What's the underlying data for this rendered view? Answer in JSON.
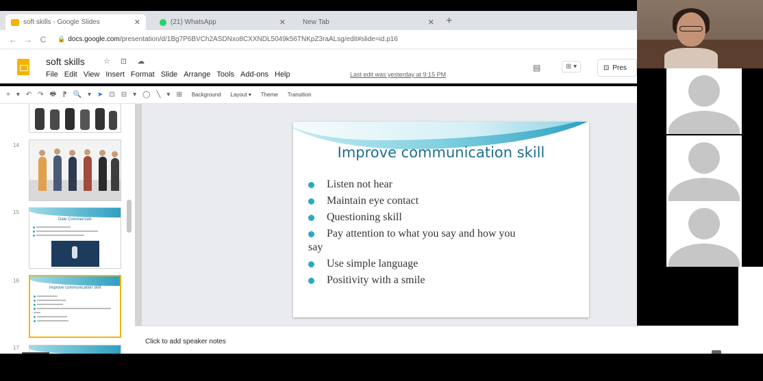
{
  "browser": {
    "tabs": [
      {
        "title": "soft skills - Google Slides",
        "active": true
      },
      {
        "title": "(21) WhatsApp",
        "active": false
      },
      {
        "title": "New Tab",
        "active": false
      }
    ],
    "new_tab": "+",
    "url": "docs.google.com/presentation/d/1Bg7P6BVCh2ASDNxo8CXXNDL5049k56TNKpZ3raALsg/edit#slide=id.p16",
    "url_host": "docs.google.com",
    "url_path": "/presentation/d/1Bg7P6BVCh2ASDNxo8CXXNDL5049k56TNKpZ3raALsg/edit#slide=id.p16"
  },
  "app": {
    "doc_title": "soft skills",
    "title_icons": "☆ ⊡ ☁",
    "menu": [
      "File",
      "Edit",
      "View",
      "Insert",
      "Format",
      "Slide",
      "Arrange",
      "Tools",
      "Add-ons",
      "Help"
    ],
    "last_edit": "Last edit was yesterday at 9:15 PM",
    "present_label": "Pres"
  },
  "toolbar": {
    "items": [
      "+",
      "▾",
      "↶",
      "↷",
      "🖶",
      "⁋",
      "🔍",
      "▾",
      "➤",
      "⊡",
      "⊟",
      "▾",
      "◯",
      "╲",
      "▾",
      "⊞"
    ],
    "background": "Background",
    "layout": "Layout ▾",
    "theme": "Theme",
    "transition": "Transition"
  },
  "filmstrip": {
    "slide_numbers": [
      "14",
      "15",
      "16",
      "17"
    ],
    "thumb15_title": "Dale Commercials",
    "thumb16_title": "Improve communication skill"
  },
  "slide": {
    "title": "Improve communication skill",
    "bullets": [
      "Listen not hear",
      "Maintain eye contact",
      "Questioning skill",
      "Pay attention to what you say and how you",
      "Use simple language",
      "Positivity with a smile"
    ],
    "bullet4_continuation": "say"
  },
  "notes": {
    "placeholder": "Click to add speaker notes"
  },
  "colors": {
    "accent_teal": "#2aa9c2",
    "title_blue": "#1d6e8f",
    "slides_yellow": "#f4b400"
  }
}
